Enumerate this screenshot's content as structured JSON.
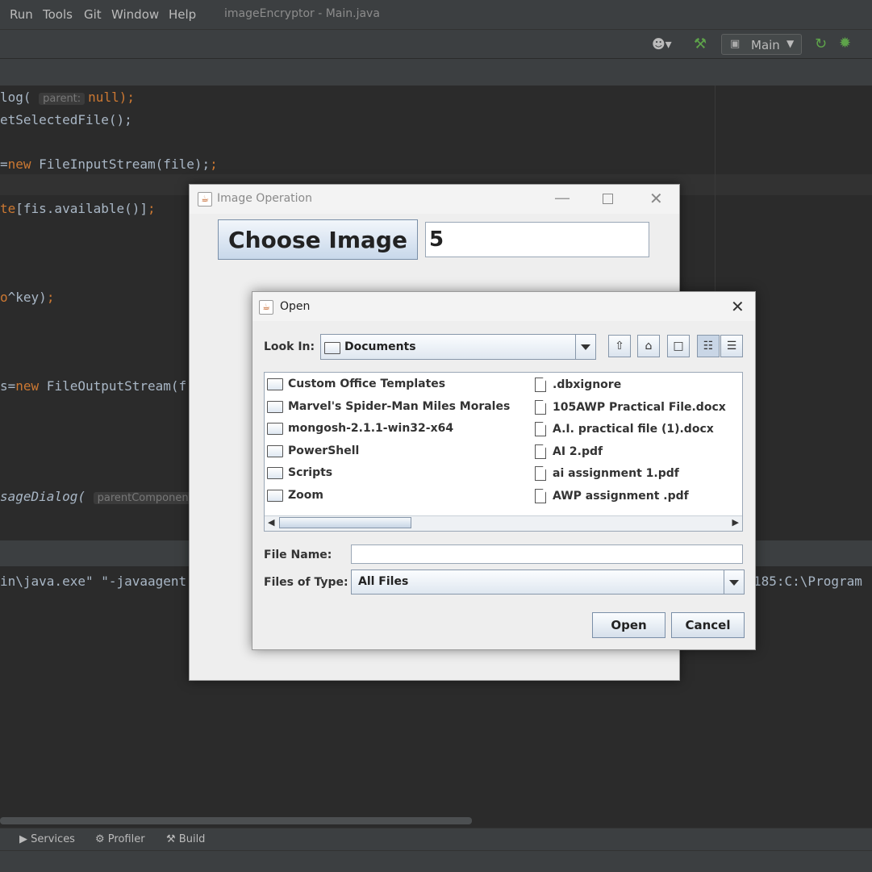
{
  "ide": {
    "menu": [
      "Run",
      "Tools",
      "Git",
      "Window",
      "Help"
    ],
    "window_title": "imageEncryptor - Main.java",
    "run_config": "Main",
    "code_lines": [
      {
        "parts": [
          "log(",
          "null);"
        ],
        "hint": "parent:"
      },
      {
        "text": "etSelectedFile();"
      },
      {
        "pre": "=",
        "kw": "new",
        "post": " FileInputStream(file);"
      },
      {
        "text": "te[fis.available()];"
      },
      {
        "text": "o^key);"
      },
      {
        "pre": "s=",
        "kw": "new",
        "post": " FileOutputStream(f"
      },
      {
        "text": "sageDialog(",
        "hint": "parentComponent"
      }
    ],
    "console_line": "in\\java.exe\" \"-javaagent",
    "console_right": "185:C:\\Program",
    "tool_windows": {
      "services": "Services",
      "profiler": "Profiler",
      "build": "Build"
    }
  },
  "image_dialog": {
    "title": "Image Operation",
    "choose_label": "Choose Image",
    "key_value": "5"
  },
  "open_dialog": {
    "title": "Open",
    "look_in_label": "Look In:",
    "look_in_value": "Documents",
    "folders": [
      "Custom Office Templates",
      "Marvel's Spider-Man Miles Morales",
      "mongosh-2.1.1-win32-x64",
      "PowerShell",
      "Scripts",
      "Zoom"
    ],
    "files": [
      ".dbxignore",
      "105AWP Practical File.docx",
      "A.I. practical file (1).docx",
      "AI 2.pdf",
      "ai assignment 1.pdf",
      "AWP assignment .pdf"
    ],
    "file_name_label": "File Name:",
    "file_name_value": "",
    "files_of_type_label": "Files of Type:",
    "files_of_type_value": "All Files",
    "open_button": "Open",
    "cancel_button": "Cancel"
  }
}
